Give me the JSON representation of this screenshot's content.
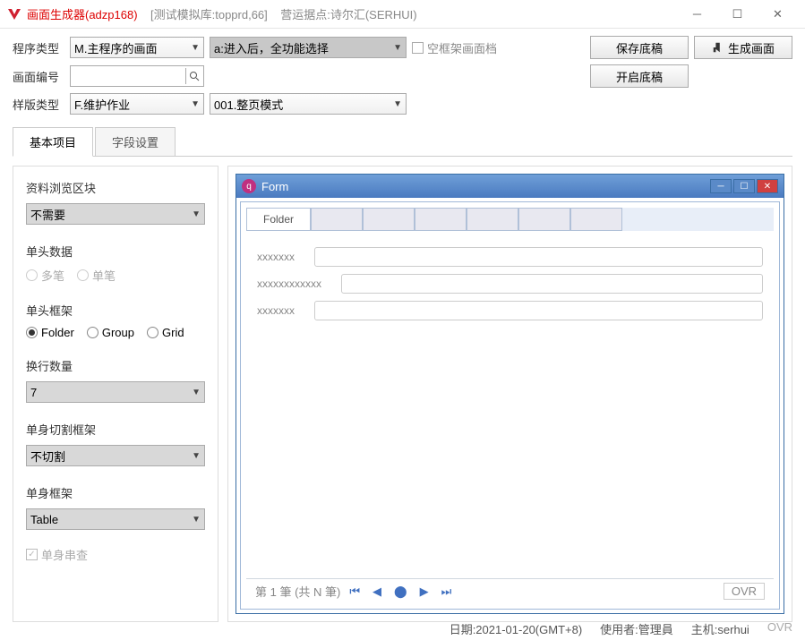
{
  "titlebar": {
    "app_name": "画面生成器(adzp168)",
    "test_lib": "[测试模拟库:topprd,66]",
    "outlet": "营运据点:诗尔汇(SERHUI)"
  },
  "toolbar": {
    "program_type_label": "程序类型",
    "program_type_value": "M.主程序的画面",
    "action_combo": "a:进入后，全功能选择",
    "empty_frame_checkbox": "空框架画面档",
    "save_draft": "保存底稿",
    "generate": "生成画面",
    "screen_no_label": "画面编号",
    "open_draft": "开启底稿",
    "template_type_label": "样版类型",
    "template_type_value": "F.维护作业",
    "mode_value": "001.整页模式"
  },
  "tabs": {
    "basic": "基本项目",
    "fields": "字段设置"
  },
  "left": {
    "browse_block_label": "资料浏览区块",
    "browse_block_value": "不需要",
    "header_data_label": "单头数据",
    "multi": "多笔",
    "single": "单笔",
    "header_frame_label": "单头框架",
    "folder": "Folder",
    "group": "Group",
    "grid": "Grid",
    "wrap_count_label": "换行数量",
    "wrap_count_value": "7",
    "body_split_label": "单身切割框架",
    "body_split_value": "不切割",
    "body_frame_label": "单身框架",
    "body_frame_value": "Table",
    "body_chain": "单身串查"
  },
  "preview": {
    "form_title": "Form",
    "folder_tab": "Folder",
    "field1": "xxxxxxx",
    "field2": "xxxxxxxxxxxx",
    "field3": "xxxxxxx",
    "pager": "第 1 筆 (共 N 筆)",
    "ovr": "OVR"
  },
  "status": {
    "date": "日期:2021-01-20(GMT+8)",
    "user": "使用者:管理員",
    "host": "主机:serhui",
    "ovr": "OVR"
  }
}
